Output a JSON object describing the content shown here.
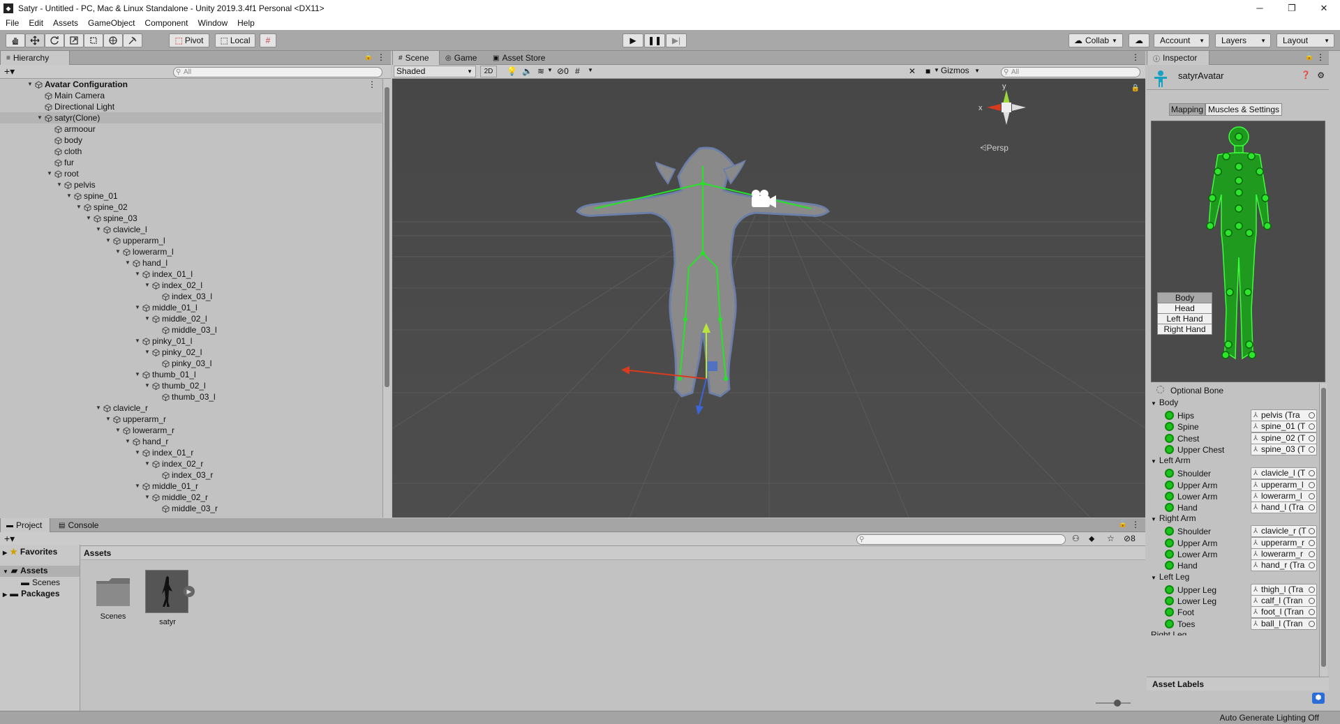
{
  "window": {
    "title": "Satyr - Untitled - PC, Mac & Linux Standalone - Unity 2019.3.4f1 Personal <DX11>",
    "minimize": "─",
    "maximize": "❐",
    "close": "✕"
  },
  "menu": [
    "File",
    "Edit",
    "Assets",
    "GameObject",
    "Component",
    "Window",
    "Help"
  ],
  "toolbar": {
    "pivot": "Pivot",
    "local": "Local",
    "collab": "Collab",
    "account": "Account",
    "layers": "Layers",
    "layout": "Layout"
  },
  "hierarchy": {
    "tab": "Hierarchy",
    "search_placeholder": "All",
    "items": [
      {
        "label": "Avatar Configuration",
        "depth": 0,
        "arrow": "▼",
        "bold": true
      },
      {
        "label": "Main Camera",
        "depth": 1,
        "arrow": ""
      },
      {
        "label": "Directional Light",
        "depth": 1,
        "arrow": ""
      },
      {
        "label": "satyr(Clone)",
        "depth": 1,
        "arrow": "▼",
        "selected": true
      },
      {
        "label": "armoour",
        "depth": 2,
        "arrow": ""
      },
      {
        "label": "body",
        "depth": 2,
        "arrow": ""
      },
      {
        "label": "cloth",
        "depth": 2,
        "arrow": ""
      },
      {
        "label": "fur",
        "depth": 2,
        "arrow": ""
      },
      {
        "label": "root",
        "depth": 2,
        "arrow": "▼"
      },
      {
        "label": "pelvis",
        "depth": 3,
        "arrow": "▼"
      },
      {
        "label": "spine_01",
        "depth": 4,
        "arrow": "▼"
      },
      {
        "label": "spine_02",
        "depth": 5,
        "arrow": "▼"
      },
      {
        "label": "spine_03",
        "depth": 6,
        "arrow": "▼"
      },
      {
        "label": "clavicle_l",
        "depth": 7,
        "arrow": "▼"
      },
      {
        "label": "upperarm_l",
        "depth": 8,
        "arrow": "▼"
      },
      {
        "label": "lowerarm_l",
        "depth": 9,
        "arrow": "▼"
      },
      {
        "label": "hand_l",
        "depth": 10,
        "arrow": "▼"
      },
      {
        "label": "index_01_l",
        "depth": 11,
        "arrow": "▼"
      },
      {
        "label": "index_02_l",
        "depth": 12,
        "arrow": "▼"
      },
      {
        "label": "index_03_l",
        "depth": 13,
        "arrow": ""
      },
      {
        "label": "middle_01_l",
        "depth": 11,
        "arrow": "▼"
      },
      {
        "label": "middle_02_l",
        "depth": 12,
        "arrow": "▼"
      },
      {
        "label": "middle_03_l",
        "depth": 13,
        "arrow": ""
      },
      {
        "label": "pinky_01_l",
        "depth": 11,
        "arrow": "▼"
      },
      {
        "label": "pinky_02_l",
        "depth": 12,
        "arrow": "▼"
      },
      {
        "label": "pinky_03_l",
        "depth": 13,
        "arrow": ""
      },
      {
        "label": "thumb_01_l",
        "depth": 11,
        "arrow": "▼"
      },
      {
        "label": "thumb_02_l",
        "depth": 12,
        "arrow": "▼"
      },
      {
        "label": "thumb_03_l",
        "depth": 13,
        "arrow": ""
      },
      {
        "label": "clavicle_r",
        "depth": 7,
        "arrow": "▼"
      },
      {
        "label": "upperarm_r",
        "depth": 8,
        "arrow": "▼"
      },
      {
        "label": "lowerarm_r",
        "depth": 9,
        "arrow": "▼"
      },
      {
        "label": "hand_r",
        "depth": 10,
        "arrow": "▼"
      },
      {
        "label": "index_01_r",
        "depth": 11,
        "arrow": "▼"
      },
      {
        "label": "index_02_r",
        "depth": 12,
        "arrow": "▼"
      },
      {
        "label": "index_03_r",
        "depth": 13,
        "arrow": ""
      },
      {
        "label": "middle_01_r",
        "depth": 11,
        "arrow": "▼"
      },
      {
        "label": "middle_02_r",
        "depth": 12,
        "arrow": "▼"
      },
      {
        "label": "middle_03_r",
        "depth": 13,
        "arrow": ""
      }
    ]
  },
  "scene": {
    "tabs": [
      "Scene",
      "Game",
      "Asset Store"
    ],
    "shading": "Shaded",
    "mode_2d": "2D",
    "hidden_count": "0",
    "gizmos": "Gizmos",
    "search_placeholder": "All",
    "persp": "Persp",
    "axis_x": "x",
    "axis_y": "y"
  },
  "inspector": {
    "tab": "Inspector",
    "object_name": "satyrAvatar",
    "tabs": [
      "Mapping",
      "Muscles & Settings"
    ],
    "body_buttons": [
      "Body",
      "Head",
      "Left Hand",
      "Right Hand"
    ],
    "optional_bone": "Optional Bone",
    "groups": [
      {
        "name": "Body",
        "bones": [
          {
            "name": "Hips",
            "value": "pelvis (Tra"
          },
          {
            "name": "Spine",
            "value": "spine_01 (T"
          },
          {
            "name": "Chest",
            "value": "spine_02 (T"
          },
          {
            "name": "Upper Chest",
            "value": "spine_03 (T"
          }
        ]
      },
      {
        "name": "Left Arm",
        "bones": [
          {
            "name": "Shoulder",
            "value": "clavicle_l (T"
          },
          {
            "name": "Upper Arm",
            "value": "upperarm_l"
          },
          {
            "name": "Lower Arm",
            "value": "lowerarm_l"
          },
          {
            "name": "Hand",
            "value": "hand_l (Tra"
          }
        ]
      },
      {
        "name": "Right Arm",
        "bones": [
          {
            "name": "Shoulder",
            "value": "clavicle_r (T"
          },
          {
            "name": "Upper Arm",
            "value": "upperarm_r"
          },
          {
            "name": "Lower Arm",
            "value": "lowerarm_r"
          },
          {
            "name": "Hand",
            "value": "hand_r (Tra"
          }
        ]
      },
      {
        "name": "Left Leg",
        "bones": [
          {
            "name": "Upper Leg",
            "value": "thigh_l (Tra"
          },
          {
            "name": "Lower Leg",
            "value": "calf_l (Tran"
          },
          {
            "name": "Foot",
            "value": "foot_l (Tran"
          },
          {
            "name": "Toes",
            "value": "ball_l (Tran"
          }
        ]
      }
    ],
    "next_group_partial": "Right Leg",
    "asset_labels": "Asset Labels"
  },
  "project": {
    "tabs": [
      "Project",
      "Console"
    ],
    "hidden_count": "8",
    "favorites": "Favorites",
    "assets": "Assets",
    "scenes_folder": "Scenes",
    "packages": "Packages",
    "breadcrumb": "Assets",
    "items": [
      {
        "name": "Scenes",
        "type": "folder"
      },
      {
        "name": "satyr",
        "type": "model"
      }
    ]
  },
  "status": {
    "lighting": "Auto Generate Lighting Off"
  }
}
